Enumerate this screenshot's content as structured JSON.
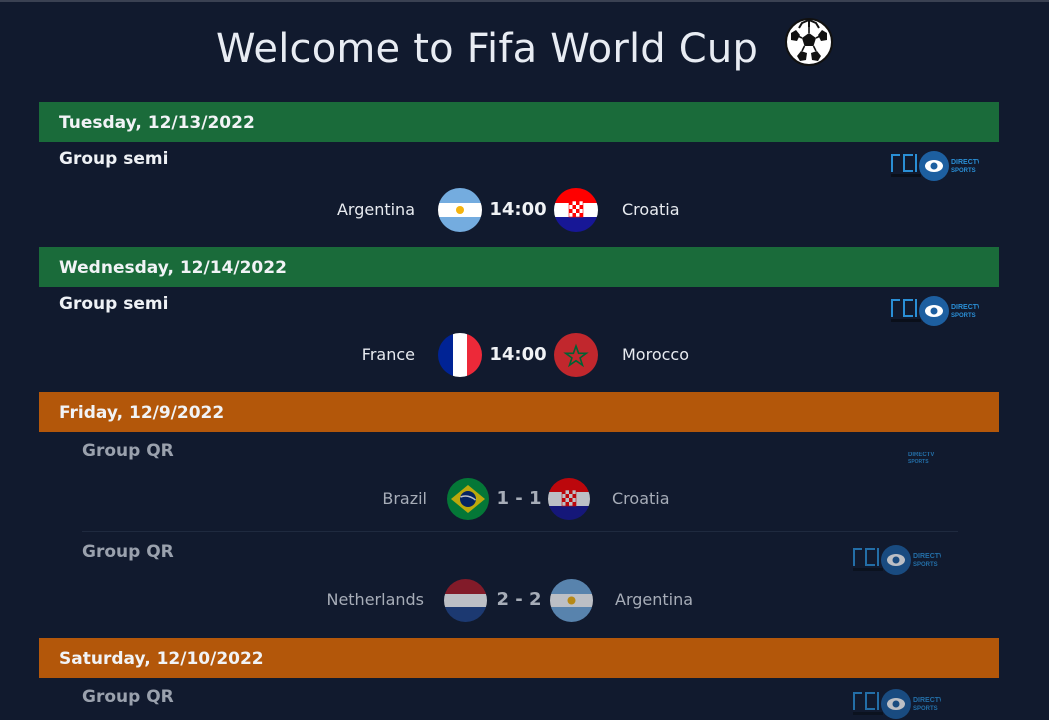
{
  "page": {
    "title": "Welcome to Fifa World Cup"
  },
  "days": [
    {
      "date": "Tuesday, 12/13/2022",
      "status": "upcoming",
      "matches": [
        {
          "group": "Group semi",
          "home": "Argentina",
          "away": "Croatia",
          "center": "14:00",
          "broadcasters": [
            "rcn-logo",
            "directv-sports-logo"
          ]
        }
      ]
    },
    {
      "date": "Wednesday, 12/14/2022",
      "status": "upcoming",
      "matches": [
        {
          "group": "Group semi",
          "home": "France",
          "away": "Morocco",
          "center": "14:00",
          "broadcasters": [
            "rcn-logo",
            "directv-sports-logo"
          ]
        }
      ]
    },
    {
      "date": "Friday, 12/9/2022",
      "status": "finished",
      "matches": [
        {
          "group": "Group QR",
          "home": "Brazil",
          "away": "Croatia",
          "center": "1 - 1",
          "broadcasters": [
            "directv-sports-logo"
          ]
        },
        {
          "group": "Group QR",
          "home": "Netherlands",
          "away": "Argentina",
          "center": "2 - 2",
          "broadcasters": [
            "rcn-logo",
            "directv-sports-logo"
          ]
        }
      ]
    },
    {
      "date": "Saturday, 12/10/2022",
      "status": "finished",
      "matches": [
        {
          "group": "Group QR",
          "broadcasters": [
            "rcn-logo",
            "directv-sports-logo"
          ]
        }
      ]
    }
  ],
  "broadcaster_text": {
    "directv_top": "DIRECTV",
    "directv_bottom": "SPORTS"
  },
  "colors": {
    "background": "#111a2e",
    "upcoming_header": "#1a6b3a",
    "finished_header": "#b3570a",
    "directv_blue": "#2a8fd6"
  }
}
